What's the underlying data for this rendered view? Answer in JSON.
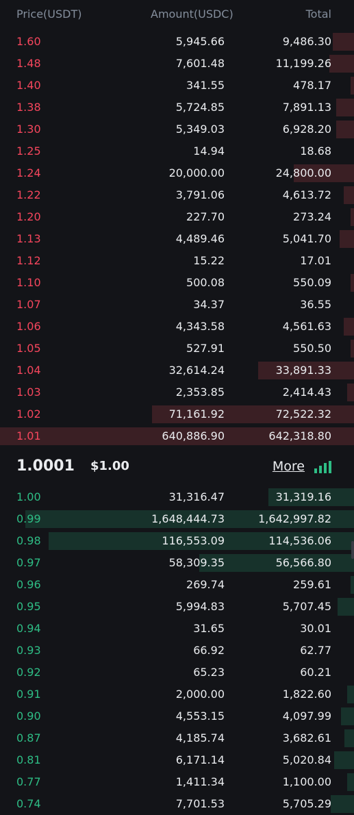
{
  "header": {
    "price": "Price(USDT)",
    "amount": "Amount(USDC)",
    "total": "Total"
  },
  "colors": {
    "ask": "#f6465d",
    "bid": "#2ebd85",
    "ask_depth": "#3a1f24",
    "bid_depth": "#17322b",
    "background": "#131418"
  },
  "asks": [
    {
      "price": "1.60",
      "amount": "5,945.66",
      "total": "9,486.30",
      "depth": 0.06
    },
    {
      "price": "1.48",
      "amount": "7,601.48",
      "total": "11,199.26",
      "depth": 0.07
    },
    {
      "price": "1.40",
      "amount": "341.55",
      "total": "478.17",
      "depth": 0.01
    },
    {
      "price": "1.38",
      "amount": "5,724.85",
      "total": "7,891.13",
      "depth": 0.05
    },
    {
      "price": "1.30",
      "amount": "5,349.03",
      "total": "6,928.20",
      "depth": 0.05
    },
    {
      "price": "1.25",
      "amount": "14.94",
      "total": "18.68",
      "depth": 0.0
    },
    {
      "price": "1.24",
      "amount": "20,000.00",
      "total": "24,800.00",
      "depth": 0.17
    },
    {
      "price": "1.22",
      "amount": "3,791.06",
      "total": "4,613.72",
      "depth": 0.03
    },
    {
      "price": "1.20",
      "amount": "227.70",
      "total": "273.24",
      "depth": 0.01
    },
    {
      "price": "1.13",
      "amount": "4,489.46",
      "total": "5,041.70",
      "depth": 0.04
    },
    {
      "price": "1.12",
      "amount": "15.22",
      "total": "17.01",
      "depth": 0.0
    },
    {
      "price": "1.10",
      "amount": "500.08",
      "total": "550.09",
      "depth": 0.01
    },
    {
      "price": "1.07",
      "amount": "34.37",
      "total": "36.55",
      "depth": 0.0
    },
    {
      "price": "1.06",
      "amount": "4,343.58",
      "total": "4,561.63",
      "depth": 0.03
    },
    {
      "price": "1.05",
      "amount": "527.91",
      "total": "550.50",
      "depth": 0.01
    },
    {
      "price": "1.04",
      "amount": "32,614.24",
      "total": "33,891.33",
      "depth": 0.27
    },
    {
      "price": "1.03",
      "amount": "2,353.85",
      "total": "2,414.43",
      "depth": 0.02
    },
    {
      "price": "1.02",
      "amount": "71,161.92",
      "total": "72,522.32",
      "depth": 0.57
    },
    {
      "price": "1.01",
      "amount": "640,886.90",
      "total": "642,318.80",
      "depth": 1.0
    }
  ],
  "mid": {
    "last_price": "1.0001",
    "usd_price": "$1.00",
    "more_label": "More"
  },
  "bids": [
    {
      "price": "1.00",
      "amount": "31,316.47",
      "total": "31,319.16",
      "depth": 0.26
    },
    {
      "price": "0.99",
      "amount": "1,648,444.73",
      "total": "1,642,997.82",
      "depth": 1.0
    },
    {
      "price": "0.98",
      "amount": "116,553.09",
      "total": "114,536.06",
      "depth": 0.93
    },
    {
      "price": "0.97",
      "amount": "58,309.35",
      "total": "56,566.80",
      "depth": 0.47
    },
    {
      "price": "0.96",
      "amount": "269.74",
      "total": "259.61",
      "depth": 0.01
    },
    {
      "price": "0.95",
      "amount": "5,994.83",
      "total": "5,707.45",
      "depth": 0.05
    },
    {
      "price": "0.94",
      "amount": "31.65",
      "total": "30.01",
      "depth": 0.0
    },
    {
      "price": "0.93",
      "amount": "66.92",
      "total": "62.77",
      "depth": 0.0
    },
    {
      "price": "0.92",
      "amount": "65.23",
      "total": "60.21",
      "depth": 0.0
    },
    {
      "price": "0.91",
      "amount": "2,000.00",
      "total": "1,822.60",
      "depth": 0.02
    },
    {
      "price": "0.90",
      "amount": "4,553.15",
      "total": "4,097.99",
      "depth": 0.04
    },
    {
      "price": "0.87",
      "amount": "4,185.74",
      "total": "3,682.61",
      "depth": 0.03
    },
    {
      "price": "0.81",
      "amount": "6,171.14",
      "total": "5,020.84",
      "depth": 0.06
    },
    {
      "price": "0.77",
      "amount": "1,411.34",
      "total": "1,100.00",
      "depth": 0.02
    },
    {
      "price": "0.74",
      "amount": "7,701.53",
      "total": "5,705.29",
      "depth": 0.07
    }
  ]
}
